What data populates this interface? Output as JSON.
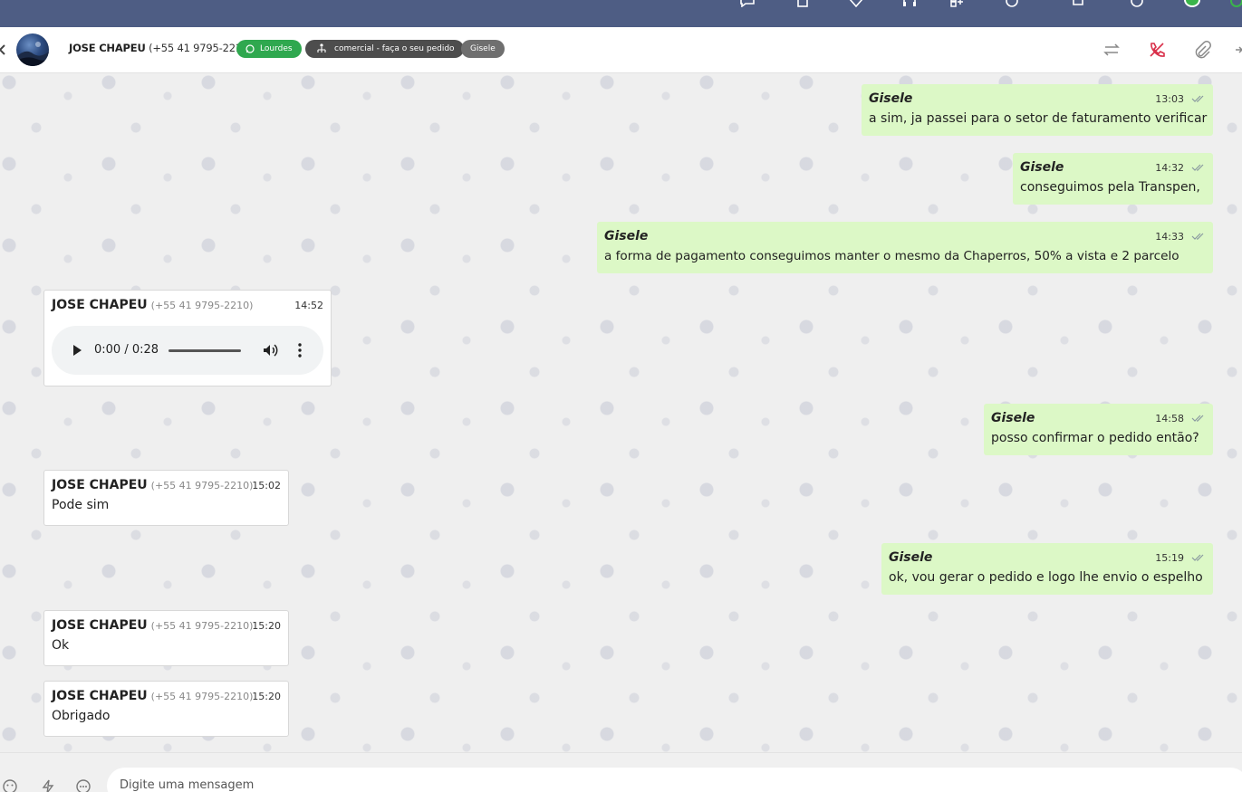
{
  "contact": {
    "name": "JOSE CHAPEU",
    "phone": "(+55 41 9795-2210)"
  },
  "tags": {
    "channel": "Lourdes",
    "department": "comercial - faça o seu pedido",
    "agent": "Gisele"
  },
  "messages": [
    {
      "sender": "Gisele",
      "time": "13:03",
      "text": "a sim, ja passei para o setor de faturamento verificar"
    },
    {
      "sender": "Gisele",
      "time": "14:32",
      "text": "conseguimos pela Transpen,"
    },
    {
      "sender": "Gisele",
      "time": "14:33",
      "text": "a forma de pagamento conseguimos manter o mesmo da Chaperros, 50% a vista e 2 parcelo"
    },
    {
      "sender": "JOSE CHAPEU",
      "phone": "(+55 41 9795-2210)",
      "time": "14:52",
      "audio": {
        "time_display": "0:00 / 0:28"
      }
    },
    {
      "sender": "Gisele",
      "time": "14:58",
      "text": "posso confirmar o pedido então?"
    },
    {
      "sender": "JOSE CHAPEU",
      "phone": "(+55 41 9795-2210)",
      "time": "15:02",
      "text": "Pode sim"
    },
    {
      "sender": "Gisele",
      "time": "15:19",
      "text": "ok, vou gerar o pedido e logo lhe envio o espelho"
    },
    {
      "sender": "JOSE CHAPEU",
      "phone": "(+55 41 9795-2210)",
      "time": "15:20",
      "text": "Ok"
    },
    {
      "sender": "JOSE CHAPEU",
      "phone": "(+55 41 9795-2210)",
      "time": "15:20",
      "text": "Obrigado"
    }
  ],
  "composer": {
    "placeholder": "Digite uma mensagem"
  },
  "colors": {
    "topbar": "#4e5d84",
    "outgoing_bubble": "#dcf8c6",
    "incoming_bubble": "#ffffff",
    "whatsapp_tag": "#2fa84f",
    "call_end": "#d9304a"
  },
  "icons": {
    "topbar": [
      "chat-icon",
      "clipboard-icon",
      "heart-icon",
      "headset-icon",
      "apps-icon",
      "info-icon",
      "bell-icon",
      "smile-icon",
      "online-status-icon",
      "chevron-icon"
    ],
    "header": [
      "transfer-icon",
      "end-call-icon",
      "paperclip-icon",
      "more-icon"
    ],
    "composer": [
      "emoji-icon",
      "quick-reply-icon",
      "options-icon"
    ]
  }
}
